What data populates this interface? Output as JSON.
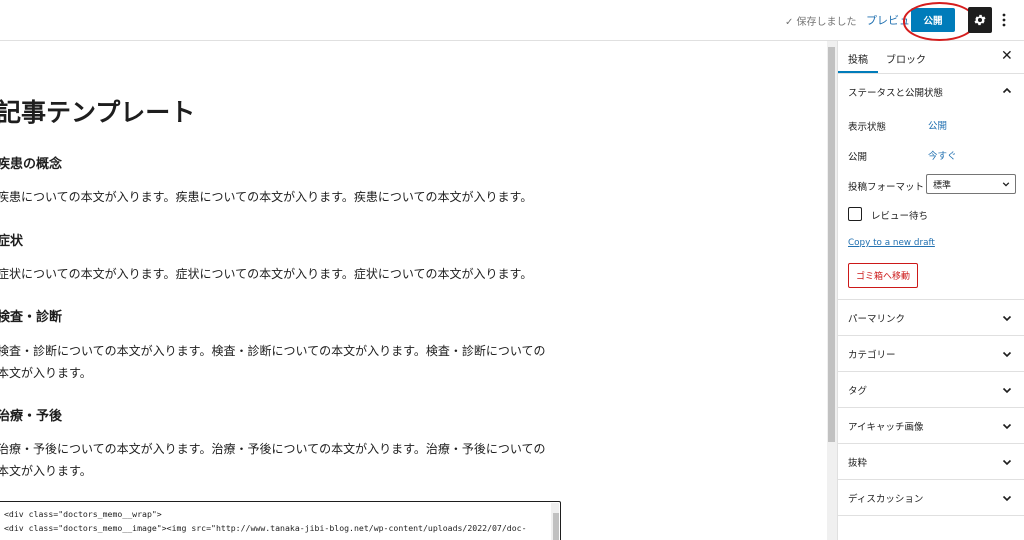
{
  "header": {
    "saved_status": "✓ 保存しました",
    "preview_label": "プレビュー",
    "publish_label": "公開",
    "settings_icon": "gear-icon",
    "more_icon": "more-vertical-icon"
  },
  "editor": {
    "title": "記事テンプレート",
    "blocks": [
      {
        "heading": "疾患の概念",
        "body": [
          "疾患についての本文が入ります。疾患についての本文が入ります。疾患についての本文が入ります。"
        ]
      },
      {
        "heading": "症状",
        "body": [
          "症状についての本文が入ります。症状についての本文が入ります。症状についての本文が入ります。"
        ]
      },
      {
        "heading": "検査・診断",
        "body": [
          "検査・診断についての本文が入ります。検査・診断についての本文が入ります。検査・診断についての",
          "本文が入ります。"
        ]
      },
      {
        "heading": "治療・予後",
        "body": [
          "治療・予後についての本文が入ります。治療・予後についての本文が入ります。治療・予後についての",
          "本文が入ります。"
        ]
      }
    ],
    "code_lines": [
      "<div class=\"doctors_memo__wrap\">",
      "<div class=\"doctors_memo__image\"><img src=\"http://www.tanaka-jibi-blog.net/wp-content/uploads/2022/07/doc-"
    ]
  },
  "sidebar": {
    "tabs": [
      "投稿",
      "ブロック"
    ],
    "status_panel": {
      "title": "ステータスと公開状態",
      "visibility_label": "表示状態",
      "visibility_value": "公開",
      "publish_label": "公開",
      "publish_value": "今すぐ",
      "format_label": "投稿フォーマット",
      "format_value": "標準",
      "pending_review_label": "レビュー待ち",
      "pending_review_checked": false,
      "copy_draft_link": "Copy to a new draft",
      "trash_label": "ゴミ箱へ移動"
    },
    "panels": [
      "パーマリンク",
      "カテゴリー",
      "タグ",
      "アイキャッチ画像",
      "抜粋",
      "ディスカッション"
    ]
  },
  "colors": {
    "accent": "#007cba",
    "link": "#2271b1",
    "danger": "#cc1818",
    "highlight_ring": "#d61d1d"
  }
}
